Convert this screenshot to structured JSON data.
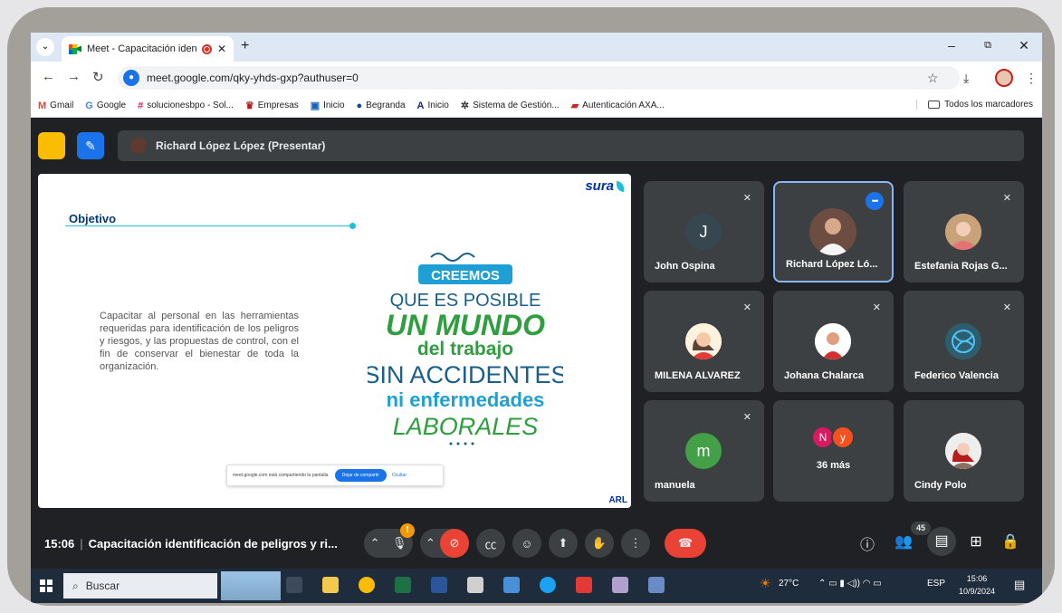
{
  "browser": {
    "tab_title": "Meet - Capacitación identif",
    "url": "meet.google.com/qky-yhds-gxp?authuser=0",
    "bookmarks": [
      {
        "icon": "gmail-icon",
        "label": "Gmail"
      },
      {
        "icon": "google-icon",
        "label": "Google"
      },
      {
        "icon": "slack-icon",
        "label": "solucionesbpo - Sol..."
      },
      {
        "icon": "shield-icon",
        "label": "Empresas"
      },
      {
        "icon": "app-icon",
        "label": "Inicio"
      },
      {
        "icon": "begranda-icon",
        "label": "Begranda"
      },
      {
        "icon": "a-icon",
        "label": "Inicio"
      },
      {
        "icon": "gear-icon",
        "label": "Sistema de Gestión..."
      },
      {
        "icon": "axa-icon",
        "label": "Autenticación AXA..."
      }
    ],
    "all_bookmarks": "Todos los marcadores"
  },
  "meet": {
    "presenter": "Richard López López (Presentar)",
    "slide": {
      "brand": "sura",
      "heading": "Objetivo",
      "body": "Capacitar al personal en las herramientas requeridas para identificación de los peligros y riesgos, y las propuestas de control, con el fin de conservar el bienestar de toda la organización.",
      "poster_lines": [
        "CREEMOS",
        "QUE ES POSIBLE",
        "UN MUNDO",
        "del trabajo",
        "SIN ACCIDENTES",
        "ni enfermedades",
        "LABORALES"
      ],
      "share_text": "meet.google.com está compartiendo tu pantalla.",
      "stop_share": "Dejar de compartir",
      "hide": "Ocultar",
      "footer": "ARL"
    },
    "participants": [
      {
        "name": "John Ospina",
        "initial": "J",
        "color": "#37474f",
        "muted": true
      },
      {
        "name": "Richard López Ló...",
        "initial": "",
        "color": "#5f3a2e",
        "muted": false,
        "speaking": true
      },
      {
        "name": "Estefania Rojas G...",
        "initial": "",
        "color": "#e8b4a8",
        "muted": true
      },
      {
        "name": "MILENA ALVAREZ",
        "initial": "",
        "color": "#f3c9b6",
        "muted": true
      },
      {
        "name": "Johana Chalarca",
        "initial": "",
        "color": "#ffffff",
        "muted": true
      },
      {
        "name": "Federico Valencia",
        "initial": "",
        "color": "#2e5e6e",
        "muted": true
      },
      {
        "name": "manuela",
        "initial": "m",
        "color": "#43a047",
        "muted": true
      },
      {
        "name": "Cindy Polo",
        "initial": "",
        "color": "#f0d0c8",
        "muted": false
      }
    ],
    "more": {
      "badges": [
        {
          "letter": "N",
          "color": "#d81b60"
        },
        {
          "letter": "y",
          "color": "#f4511e"
        }
      ],
      "label": "36 más"
    },
    "controls": {
      "time": "15:06",
      "meeting_title": "Capacitación identificación de peligros y ri...",
      "participant_count": "45"
    }
  },
  "taskbar": {
    "search": "Buscar",
    "temperature": "27°C",
    "language": "ESP",
    "time": "15:06",
    "date": "10/9/2024"
  }
}
